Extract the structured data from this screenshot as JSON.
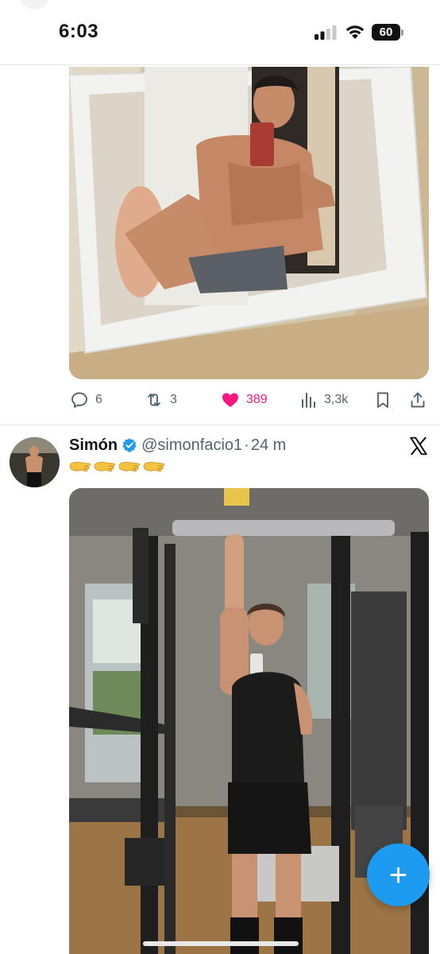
{
  "status_bar": {
    "time": "6:03",
    "battery_level": "60"
  },
  "post_1": {
    "actions": {
      "replies": "6",
      "reposts": "3",
      "likes": "389",
      "views": "3,3k"
    },
    "liked_color": "#f91880"
  },
  "post_2": {
    "display_name": "Simón",
    "handle": "@simonfacio1",
    "separator": "·",
    "time": "24 m",
    "emoji_text": "🫳🫳🫳🫳"
  },
  "accent_color": "#1d9bf0",
  "compose_button_label": "+"
}
